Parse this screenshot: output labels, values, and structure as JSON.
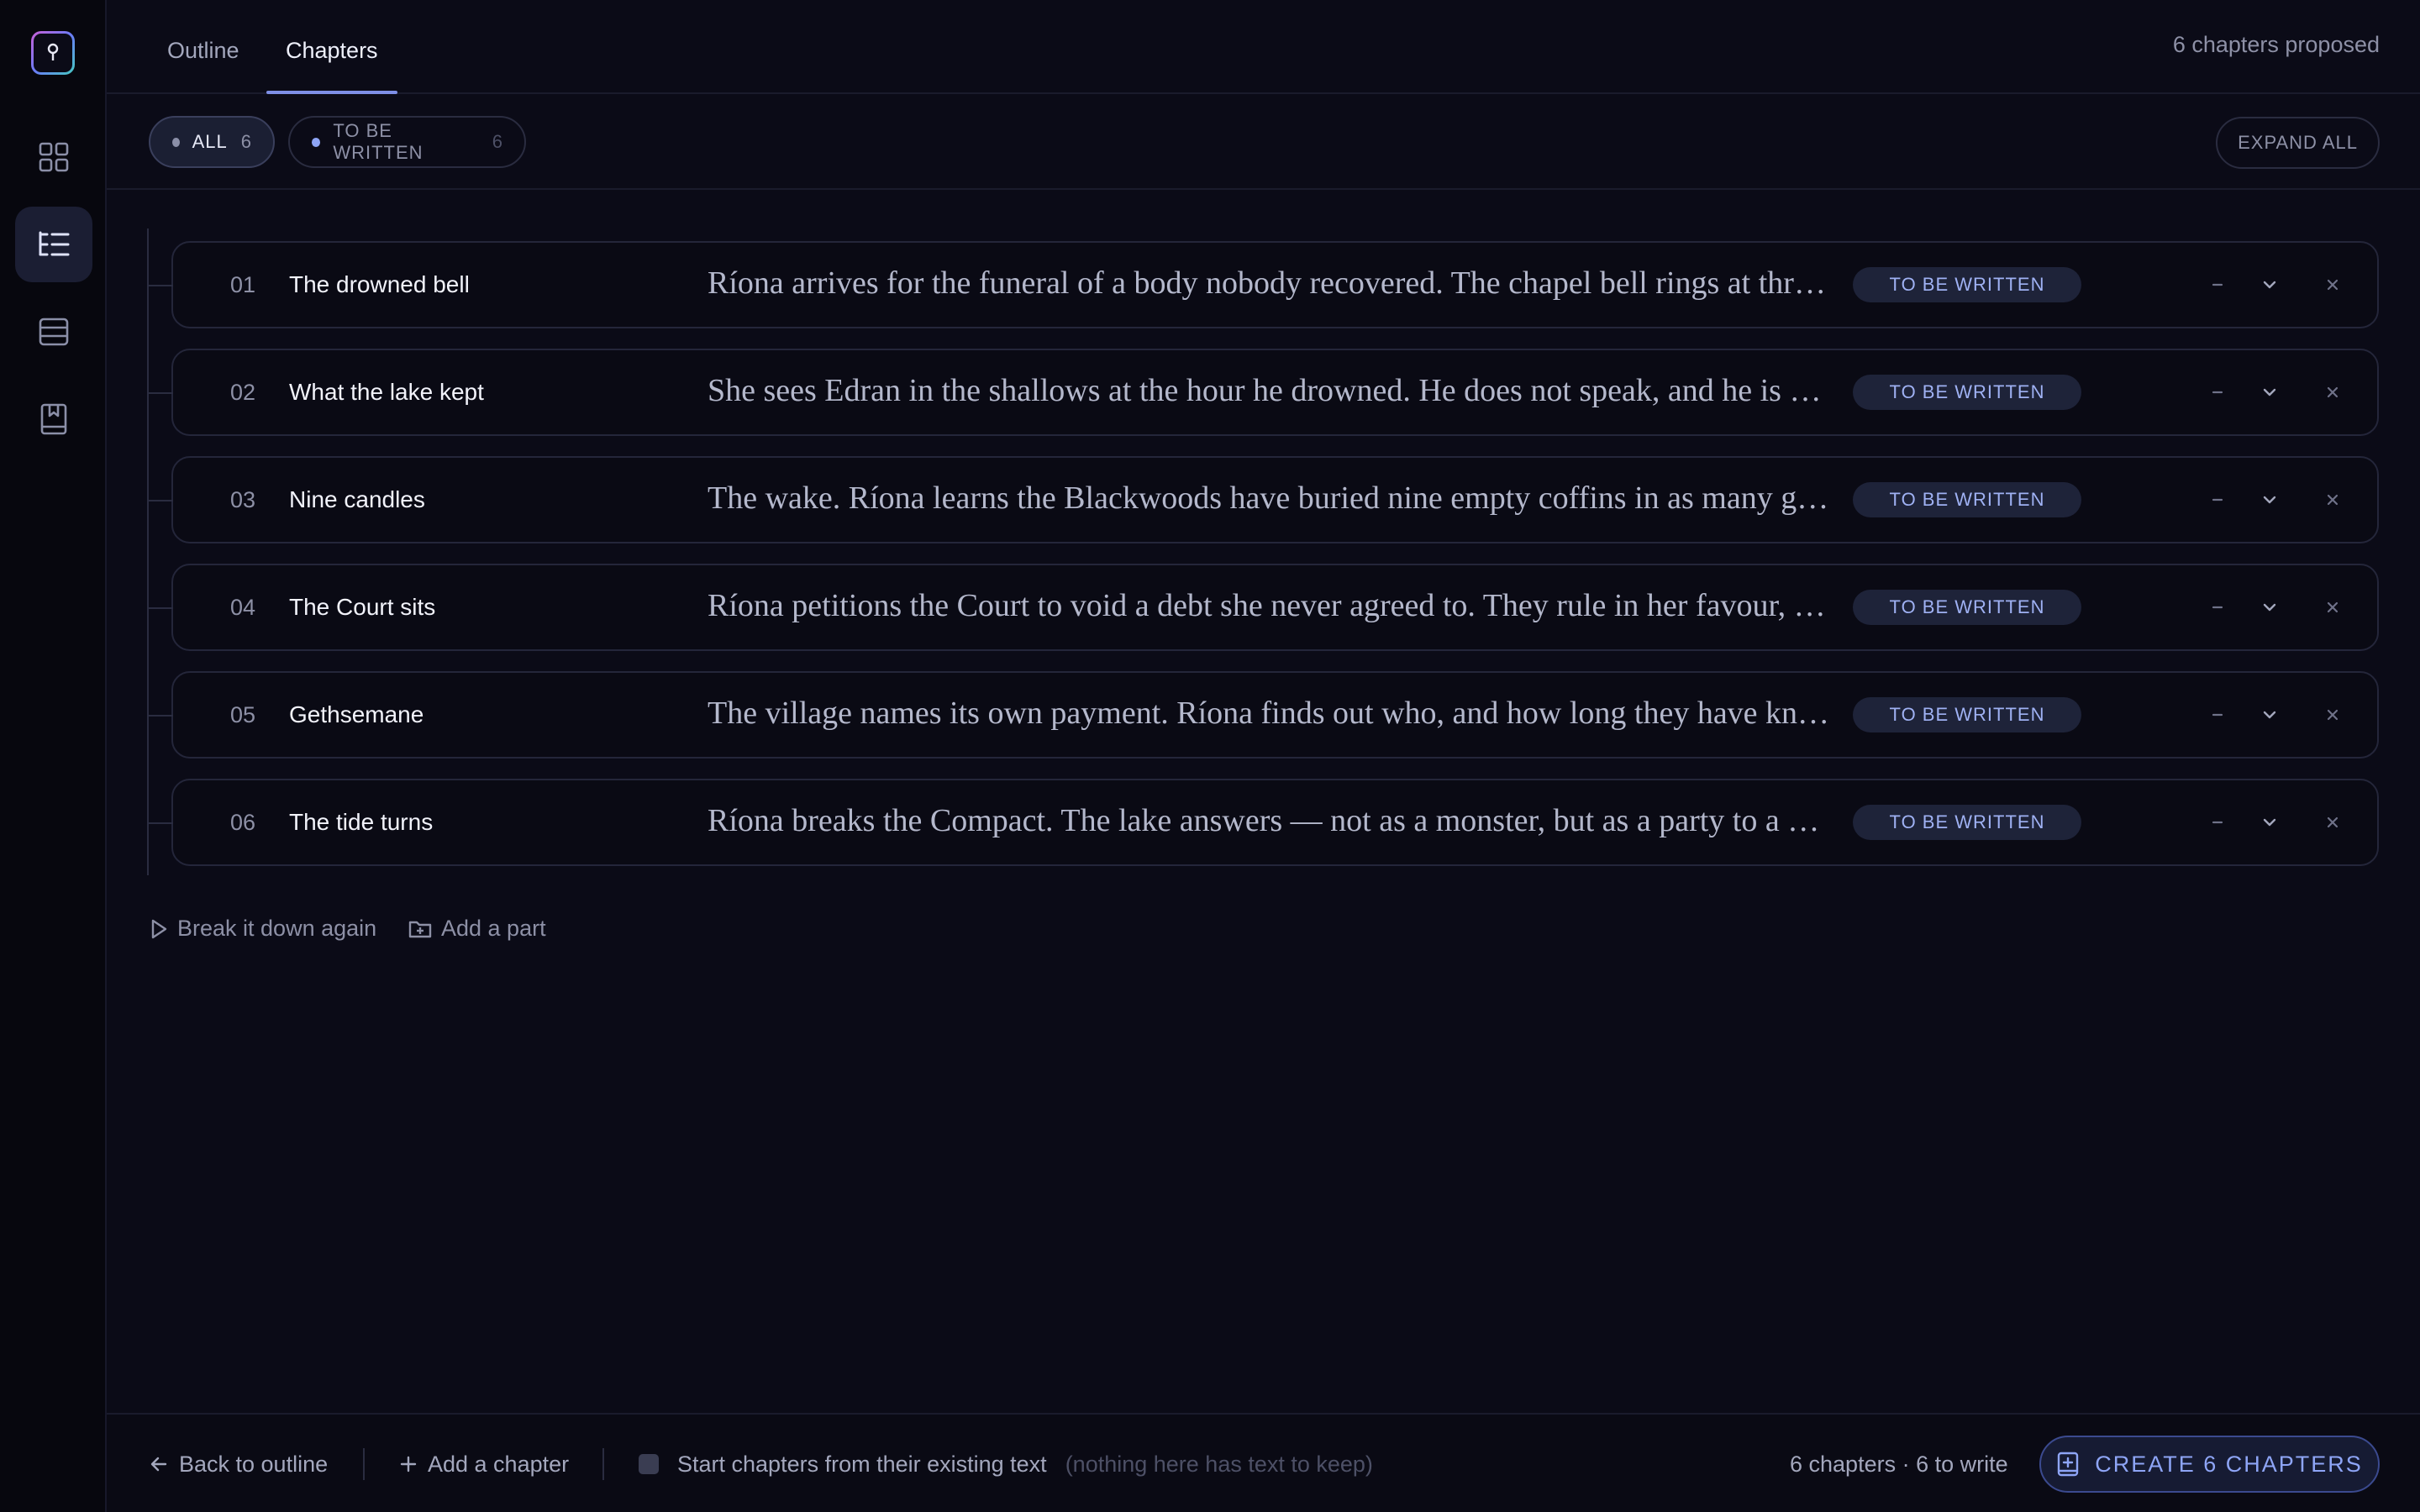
{
  "tabs": [
    {
      "label": "Outline",
      "active": false
    },
    {
      "label": "Chapters",
      "active": true
    }
  ],
  "proposed_label": "6 chapters proposed",
  "filters": {
    "all_label": "ALL",
    "all_count": "6",
    "tbw_label": "TO BE WRITTEN",
    "tbw_count": "6",
    "expand_all": "EXPAND ALL"
  },
  "chapters": [
    {
      "num": "01",
      "title": "The drowned bell",
      "summary": "Ríona arrives for the funeral of a body nobody recovered. The chapel bell rings at three in the morning, and no one in the house will say who pulls the rope.",
      "status": "TO BE WRITTEN"
    },
    {
      "num": "02",
      "title": "What the lake kept",
      "summary": "She sees Edran in the shallows at the hour he drowned. He does not speak, and he is not alone in the water.",
      "status": "TO BE WRITTEN"
    },
    {
      "num": "03",
      "title": "Nine candles",
      "summary": "The wake. Ríona learns the Blackwoods have buried nine empty coffins in as many generations, and every one was a firstborn.",
      "status": "TO BE WRITTEN"
    },
    {
      "num": "04",
      "title": "The Court sits",
      "summary": "Ríona petitions the Court to void a debt she never agreed to. They rule in her favour, and that is the worst thing that could happen.",
      "status": "TO BE WRITTEN"
    },
    {
      "num": "05",
      "title": "Gethsemane",
      "summary": "The village names its own payment. Ríona finds out who, and how long they have known it would be them.",
      "status": "TO BE WRITTEN"
    },
    {
      "num": "06",
      "title": "The tide turns",
      "summary": "Ríona breaks the Compact. The lake answers — not as a monster, but as a party to a contract that was never honoured.",
      "status": "TO BE WRITTEN"
    }
  ],
  "actions": {
    "break_down": "Break it down again",
    "add_part": "Add a part"
  },
  "footer": {
    "back": "Back to outline",
    "add_chapter": "Add a chapter",
    "start_from_text": "Start chapters from their existing text",
    "start_hint": "(nothing here has text to keep)",
    "summary": "6 chapters · 6 to write",
    "create": "CREATE 6 CHAPTERS"
  },
  "colors": {
    "accent": "#7e8fe6",
    "badge_text": "#9fb1f3",
    "background": "#0b0b17"
  }
}
